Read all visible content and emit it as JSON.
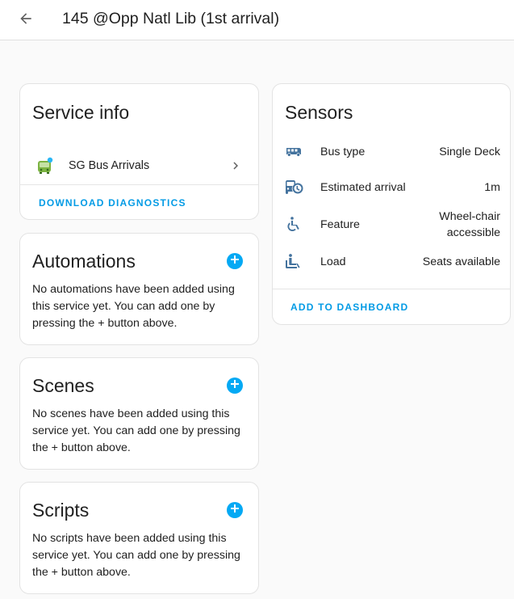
{
  "header": {
    "title": "145 @Opp Natl Lib (1st arrival)",
    "back_icon": "arrow-left-icon"
  },
  "service_info": {
    "title": "Service info",
    "integration_label": "SG Bus Arrivals",
    "integration_icon": "bus-integration-logo",
    "download_label": "DOWNLOAD DIAGNOSTICS"
  },
  "automations": {
    "title": "Automations",
    "empty_text": "No automations have been added using this service yet. You can add one by pressing the + button above."
  },
  "scenes": {
    "title": "Scenes",
    "empty_text": "No scenes have been added using this service yet. You can add one by pressing the + button above."
  },
  "scripts": {
    "title": "Scripts",
    "empty_text": "No scripts have been added using this service yet. You can add one by pressing the + button above."
  },
  "sensors": {
    "title": "Sensors",
    "items": [
      {
        "name": "Bus type",
        "value": "Single Deck",
        "icon": "bus-side-icon"
      },
      {
        "name": "Estimated arrival",
        "value": "1m",
        "icon": "bus-clock-icon"
      },
      {
        "name": "Feature",
        "value": "Wheel-chair accessible",
        "icon": "wheelchair-icon"
      },
      {
        "name": "Load",
        "value": "Seats available",
        "icon": "seat-passenger-icon"
      }
    ],
    "add_label": "ADD TO DASHBOARD"
  },
  "colors": {
    "accent": "#03a9f4",
    "link": "#039be5",
    "icon": "#44739e"
  }
}
